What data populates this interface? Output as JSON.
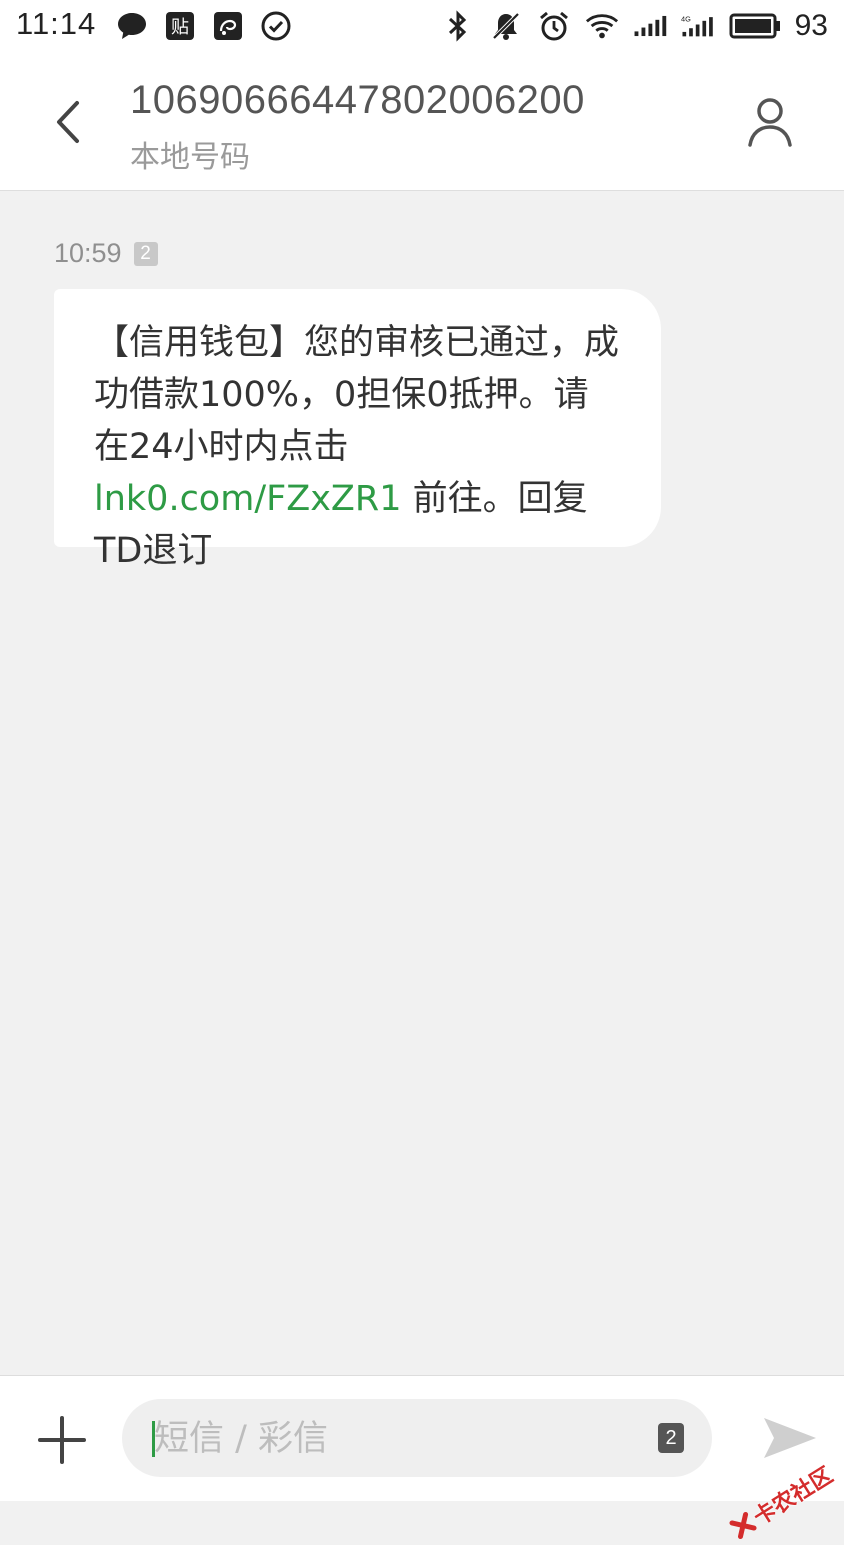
{
  "status_bar": {
    "time": "11:14",
    "left_icons": [
      "chat-bubble-icon",
      "tieba-icon",
      "uc-browser-icon",
      "check-circle-icon"
    ],
    "right_icons": [
      "bluetooth-icon",
      "mute-bell-icon",
      "alarm-icon",
      "wifi-icon",
      "signal-icon",
      "signal-4g-icon",
      "battery-icon"
    ],
    "battery_percent": 93
  },
  "header": {
    "contact_number": "106906664478020062​00",
    "contact_subtitle": "本地号码"
  },
  "message": {
    "time": "10:59",
    "sim_slot": "2",
    "text_part1": "【信用钱包】您的审核已通过，成功借款100%，0担保0抵押。请在24小时内点击 ",
    "link": "lnk0.com/FZxZR1",
    "text_part2": " 前往。回复TD退订"
  },
  "composer": {
    "placeholder": "短信 / 彩信",
    "value": "",
    "sim_slot": "2"
  },
  "watermark": {
    "text": "卡农社区"
  },
  "colors": {
    "accent_green": "#2e9b45",
    "background": "#f1f1f1",
    "bubble": "#ffffff"
  }
}
